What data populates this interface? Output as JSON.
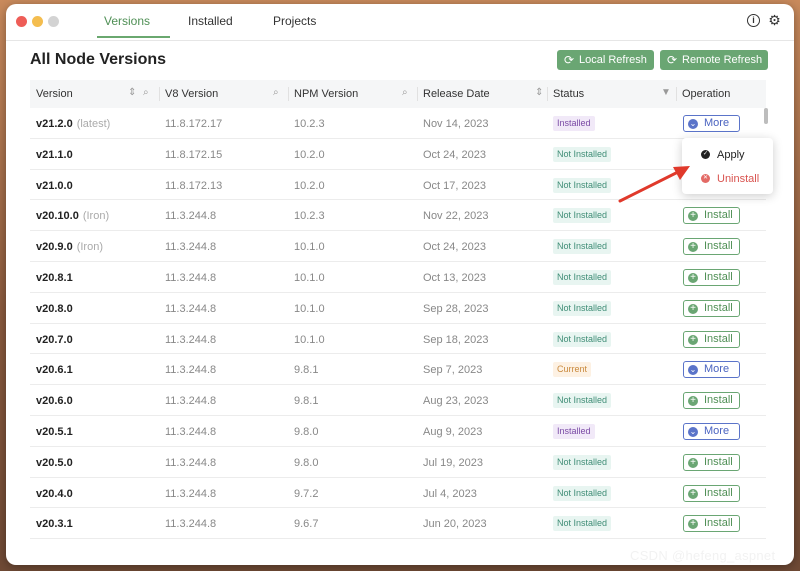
{
  "tabs": [
    {
      "label": "Versions",
      "active": true
    },
    {
      "label": "Installed",
      "active": false
    },
    {
      "label": "Projects",
      "active": false
    }
  ],
  "icons": {
    "info": "info-icon",
    "settings": "gear-icon",
    "refresh": "refresh-icon",
    "sort": "sort-icon",
    "search": "search-icon",
    "filter": "filter-icon"
  },
  "page_title": "All Node Versions",
  "buttons": {
    "local_refresh": "Local Refresh",
    "remote_refresh": "Remote Refresh"
  },
  "columns": [
    "Version",
    "V8 Version",
    "NPM Version",
    "Release Date",
    "Status",
    "Operation"
  ],
  "rows": [
    {
      "version": "v21.2.0",
      "tag": "(latest)",
      "v8": "11.8.172.17",
      "npm": "10.2.3",
      "date": "Nov 14, 2023",
      "status": "Installed",
      "op": "More"
    },
    {
      "version": "v21.1.0",
      "tag": "",
      "v8": "11.8.172.15",
      "npm": "10.2.0",
      "date": "Oct 24, 2023",
      "status": "Not Installed",
      "op": ""
    },
    {
      "version": "v21.0.0",
      "tag": "",
      "v8": "11.8.172.13",
      "npm": "10.2.0",
      "date": "Oct 17, 2023",
      "status": "Not Installed",
      "op": ""
    },
    {
      "version": "v20.10.0",
      "tag": "(Iron)",
      "v8": "11.3.244.8",
      "npm": "10.2.3",
      "date": "Nov 22, 2023",
      "status": "Not Installed",
      "op": "Install"
    },
    {
      "version": "v20.9.0",
      "tag": "(Iron)",
      "v8": "11.3.244.8",
      "npm": "10.1.0",
      "date": "Oct 24, 2023",
      "status": "Not Installed",
      "op": "Install"
    },
    {
      "version": "v20.8.1",
      "tag": "",
      "v8": "11.3.244.8",
      "npm": "10.1.0",
      "date": "Oct 13, 2023",
      "status": "Not Installed",
      "op": "Install"
    },
    {
      "version": "v20.8.0",
      "tag": "",
      "v8": "11.3.244.8",
      "npm": "10.1.0",
      "date": "Sep 28, 2023",
      "status": "Not Installed",
      "op": "Install"
    },
    {
      "version": "v20.7.0",
      "tag": "",
      "v8": "11.3.244.8",
      "npm": "10.1.0",
      "date": "Sep 18, 2023",
      "status": "Not Installed",
      "op": "Install"
    },
    {
      "version": "v20.6.1",
      "tag": "",
      "v8": "11.3.244.8",
      "npm": "9.8.1",
      "date": "Sep 7, 2023",
      "status": "Current",
      "op": "More"
    },
    {
      "version": "v20.6.0",
      "tag": "",
      "v8": "11.3.244.8",
      "npm": "9.8.1",
      "date": "Aug 23, 2023",
      "status": "Not Installed",
      "op": "Install"
    },
    {
      "version": "v20.5.1",
      "tag": "",
      "v8": "11.3.244.8",
      "npm": "9.8.0",
      "date": "Aug 9, 2023",
      "status": "Installed",
      "op": "More"
    },
    {
      "version": "v20.5.0",
      "tag": "",
      "v8": "11.3.244.8",
      "npm": "9.8.0",
      "date": "Jul 19, 2023",
      "status": "Not Installed",
      "op": "Install"
    },
    {
      "version": "v20.4.0",
      "tag": "",
      "v8": "11.3.244.8",
      "npm": "9.7.2",
      "date": "Jul 4, 2023",
      "status": "Not Installed",
      "op": "Install"
    },
    {
      "version": "v20.3.1",
      "tag": "",
      "v8": "11.3.244.8",
      "npm": "9.6.7",
      "date": "Jun 20, 2023",
      "status": "Not Installed",
      "op": "Install"
    }
  ],
  "popup_menu": {
    "items": [
      "Apply",
      "Uninstall"
    ]
  },
  "watermark": "CSDN @hefeng_aspnet",
  "colors": {
    "accent_green": "#6aa673",
    "more_blue": "#5b74c9",
    "annotation_red": "#e0392b"
  }
}
